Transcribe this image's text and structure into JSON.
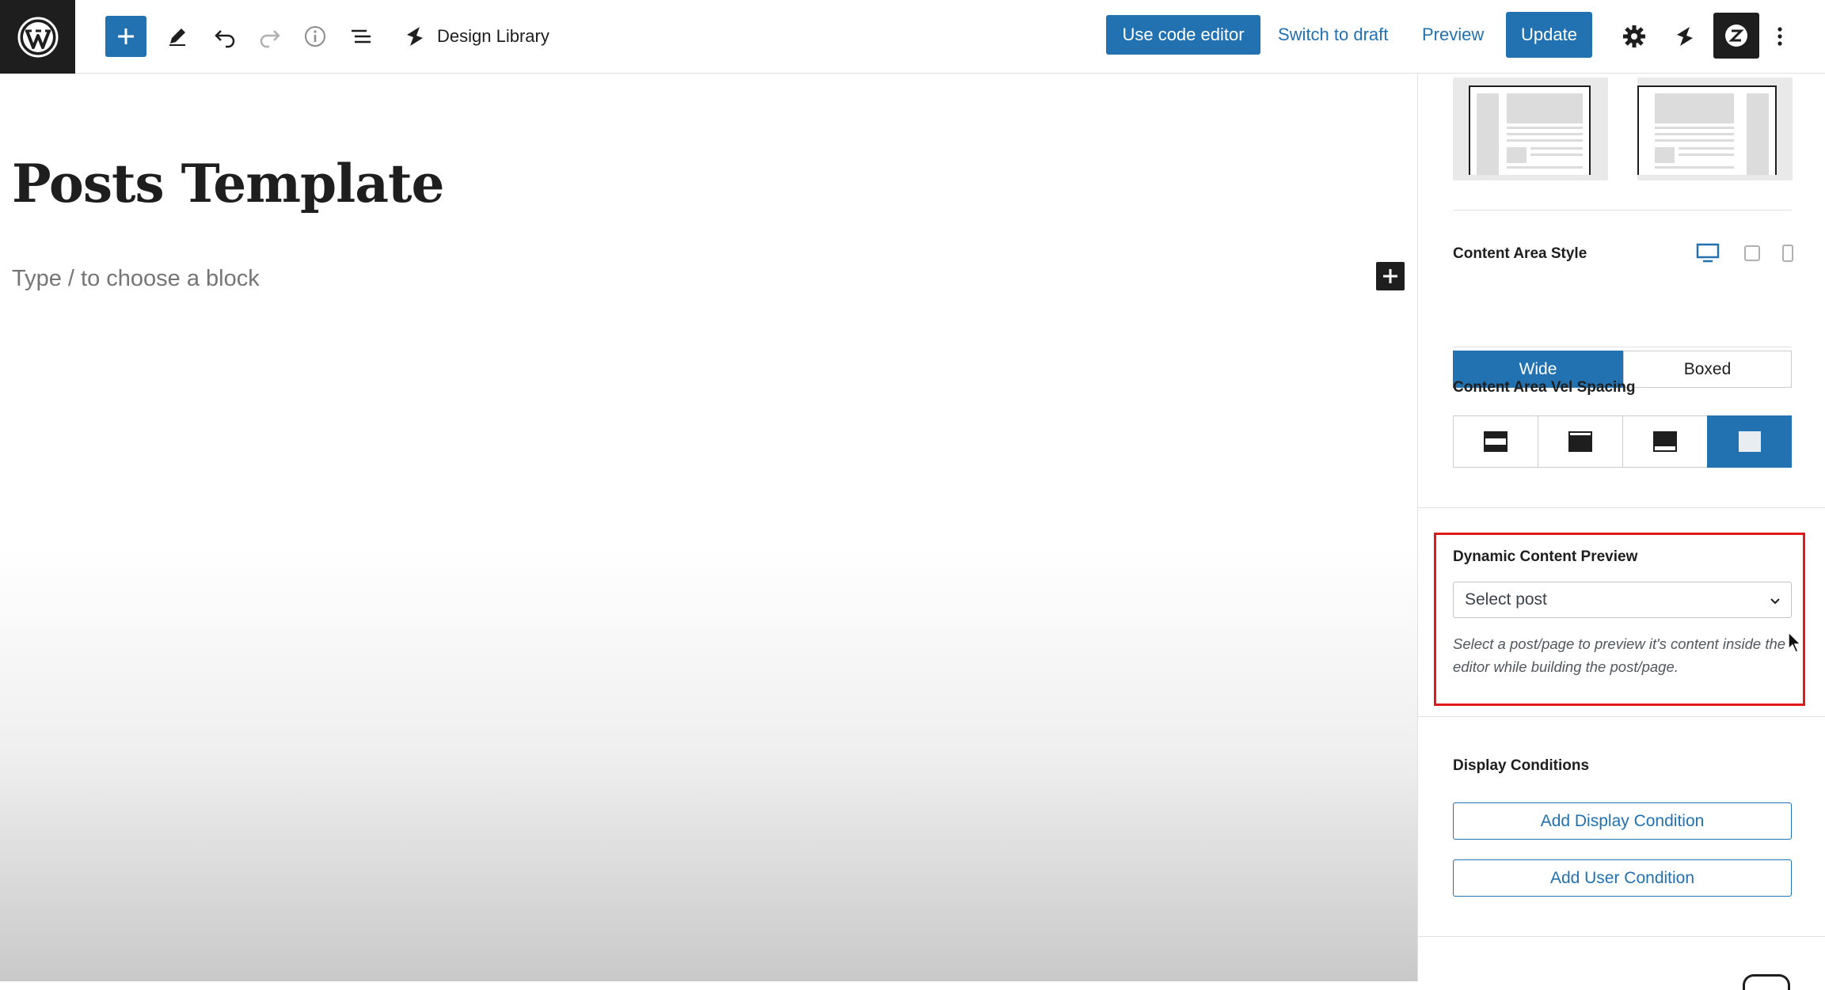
{
  "toolbar": {
    "library_label": "Design Library",
    "code_editor_label": "Use code editor",
    "switch_draft_label": "Switch to draft",
    "preview_label": "Preview",
    "update_label": "Update"
  },
  "editor": {
    "post_title": "Posts Template",
    "block_placeholder": "Type / to choose a block"
  },
  "sidebar": {
    "content_area_style": {
      "label": "Content Area Style",
      "options": [
        "Wide",
        "Boxed"
      ],
      "selected": "Wide"
    },
    "content_area_spacing": {
      "label": "Content Area Vel Spacing",
      "options": [
        "top-and-bottom-spacing",
        "top-spacing",
        "bottom-spacing",
        "no-spacing"
      ],
      "selected_index": 3
    },
    "dynamic_preview": {
      "label": "Dynamic Content Preview",
      "select_value": "Select post",
      "help": "Select a post/page to preview it's content inside the editor while building the post/page."
    },
    "display_conditions": {
      "label": "Display Conditions",
      "add_display_label": "Add Display Condition",
      "add_user_label": "Add User Condition"
    }
  },
  "colors": {
    "accent": "#2271b1",
    "highlight": "#e01919",
    "dark": "#1e1e1e"
  }
}
